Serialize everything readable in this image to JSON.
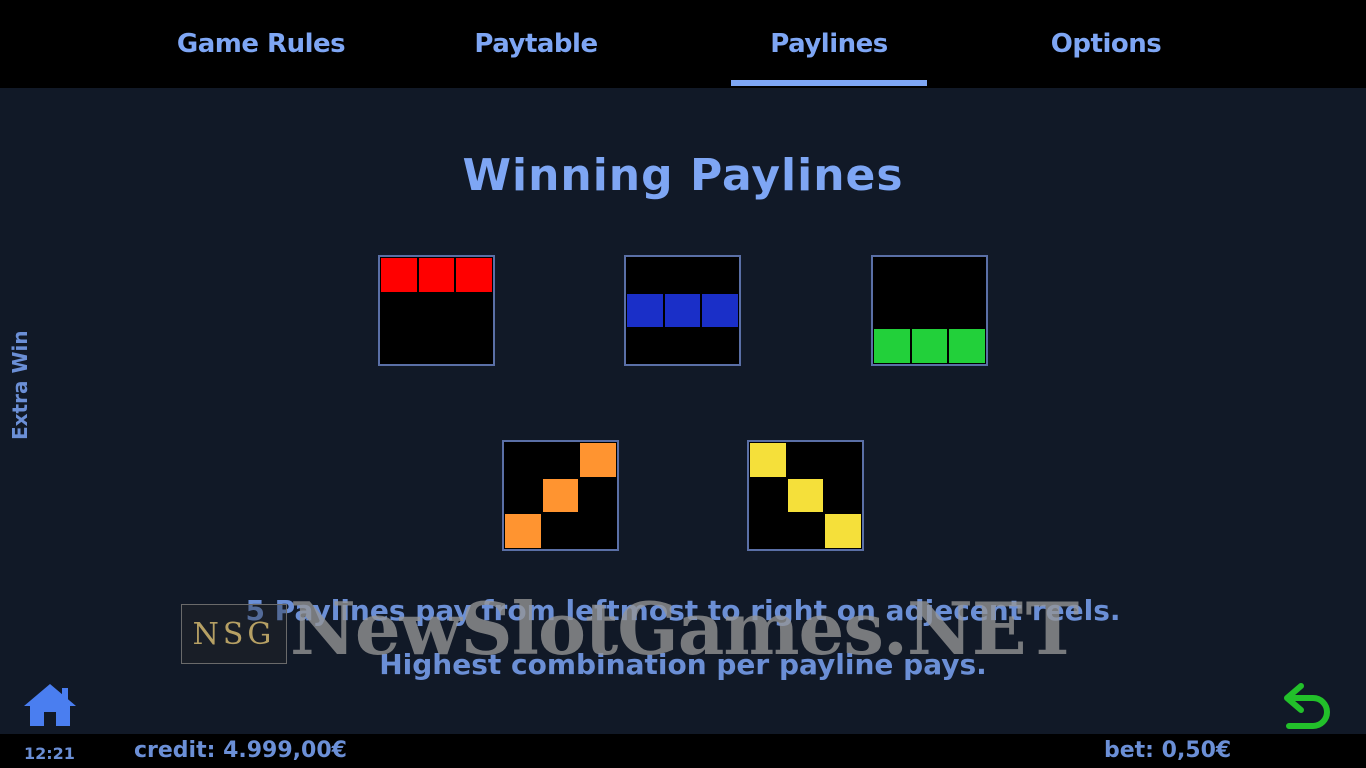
{
  "tabs": [
    {
      "label": "Game Rules",
      "active": false
    },
    {
      "label": "Paytable",
      "active": false
    },
    {
      "label": "Paylines",
      "active": true
    },
    {
      "label": "Options",
      "active": false
    }
  ],
  "side_label": "Extra Win",
  "title": "Winning Paylines",
  "paylines": [
    {
      "color": "#ff0000",
      "cells": [
        [
          1,
          1,
          1
        ],
        [
          0,
          0,
          0
        ],
        [
          0,
          0,
          0
        ]
      ]
    },
    {
      "color": "#1a2fc8",
      "cells": [
        [
          0,
          0,
          0
        ],
        [
          1,
          1,
          1
        ],
        [
          0,
          0,
          0
        ]
      ]
    },
    {
      "color": "#22d03a",
      "cells": [
        [
          0,
          0,
          0
        ],
        [
          0,
          0,
          0
        ],
        [
          1,
          1,
          1
        ]
      ]
    },
    {
      "color": "#ff9430",
      "cells": [
        [
          0,
          0,
          1
        ],
        [
          0,
          1,
          0
        ],
        [
          1,
          0,
          0
        ]
      ]
    },
    {
      "color": "#f5e03a",
      "cells": [
        [
          1,
          0,
          0
        ],
        [
          0,
          1,
          0
        ],
        [
          0,
          0,
          1
        ]
      ]
    }
  ],
  "description": {
    "line1": "5 Paylines pay from leftmost to right on adjecent reels.",
    "line2": "Highest combination per payline pays."
  },
  "watermark": {
    "logo_text": "NSG",
    "text": "NewSlotGames.NET"
  },
  "footer": {
    "clock": "12:21",
    "credit": "credit: 4.999,00€",
    "bet": "bet: 0,50€"
  },
  "icons": {
    "home": "home-icon",
    "back": "back-arrow-icon"
  },
  "colors": {
    "accent": "#7ea6f4",
    "background": "#111927",
    "bar": "#000000",
    "back_icon": "#22c02a"
  }
}
